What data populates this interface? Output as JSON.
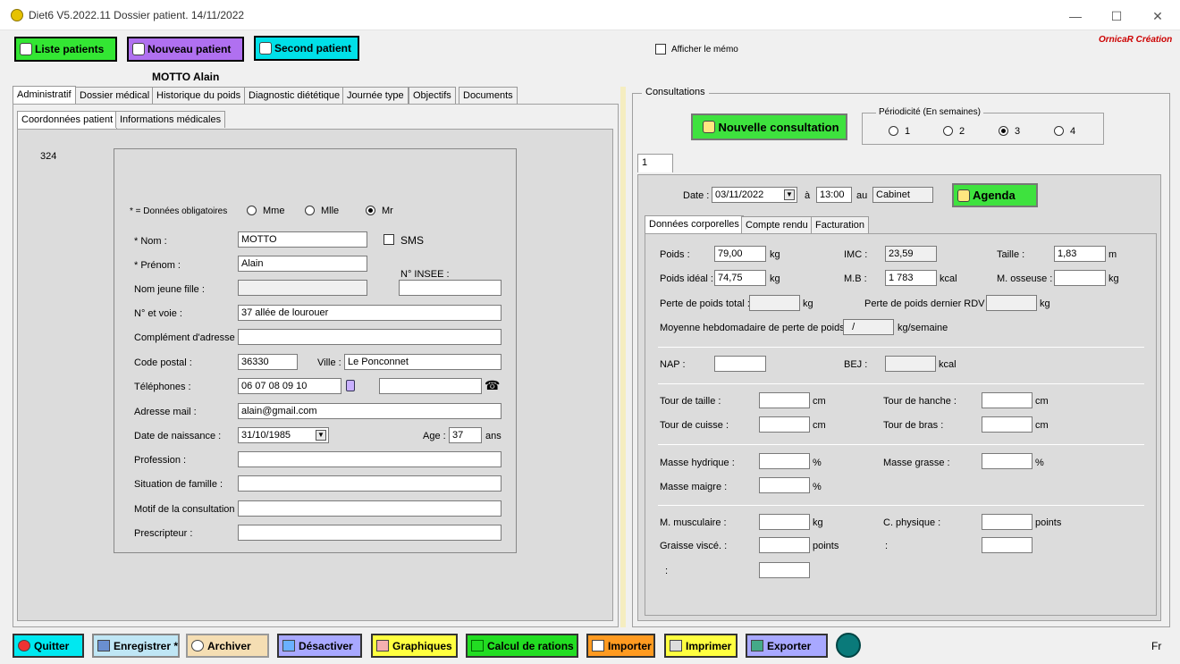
{
  "window": {
    "title": "Diet6  V5.2022.11    Dossier patient.  14/11/2022",
    "minimize": "—",
    "maximize": "☐",
    "close": "✕"
  },
  "topbar": {
    "list_patients": "Liste patients",
    "new_patient": "Nouveau patient",
    "second_patient": "Second patient",
    "show_memo": "Afficher le mémo",
    "brand": "OrnicaR Création"
  },
  "patient": {
    "name": "MOTTO Alain",
    "id": "324"
  },
  "main_tabs": [
    "Administratif",
    "Dossier médical",
    "Historique du poids",
    "Diagnostic diététique",
    "Journée type",
    "Objectifs",
    "Documents"
  ],
  "sub_tabs": [
    "Coordonnées patient",
    "Informations médicales"
  ],
  "form": {
    "required_note": "* = Données obligatoires",
    "civ_mme": "Mme",
    "civ_mlle": "Mlle",
    "civ_mr": "Mr",
    "nom_label": "* Nom :",
    "nom": "MOTTO",
    "sms": "SMS",
    "prenom_label": "* Prénom :",
    "prenom": "Alain",
    "insee_label": "N° INSEE :",
    "insee": "",
    "jeune_fille_label": "Nom jeune fille :",
    "jeune_fille": "",
    "voie_label": "N° et voie :",
    "voie": "37 allée de lourouer",
    "complement_label": "Complément d'adresse :",
    "complement": "",
    "cp_label": "Code postal :",
    "cp": "36330",
    "ville_label": "Ville :",
    "ville": "Le Ponconnet",
    "tel_label": "Téléphones :",
    "tel1": "06 07 08 09 10",
    "tel2": "",
    "mail_label": "Adresse mail :",
    "mail": "alain@gmail.com",
    "dob_label": "Date de naissance :",
    "dob": "31/10/1985",
    "age_label": "Age :",
    "age": "37",
    "ans": "ans",
    "profession_label": "Profession :",
    "profession": "",
    "situation_label": "Situation de famille :",
    "situation": "",
    "motif_label": "Motif de la consultation :",
    "motif": "",
    "prescripteur_label": "Prescripteur :",
    "prescripteur": ""
  },
  "consult": {
    "group": "Consultations",
    "new_btn": "Nouvelle consultation",
    "periodicity": "Périodicité (En semaines)",
    "p1": "1",
    "p2": "2",
    "p3": "3",
    "p4": "4",
    "number": "1",
    "date_label": "Date :",
    "date": "03/11/2022",
    "a": "à",
    "time": "13:00",
    "au": "au",
    "place": "Cabinet",
    "agenda": "Agenda",
    "tabs": [
      "Données corporelles",
      "Compte rendu",
      "Facturation"
    ],
    "poids_label": "Poids :",
    "poids": "79,00",
    "kg": "kg",
    "imc_label": "IMC :",
    "imc": "23,59",
    "taille_label": "Taille :",
    "taille": "1,83",
    "m": "m",
    "ideal_label": "Poids idéal :",
    "ideal": "74,75",
    "mb_label": "M.B :",
    "mb": "1 783",
    "kcal": "kcal",
    "osseuse_label": "M. osseuse :",
    "perte_total_label": "Perte de poids total :",
    "perte_rdv_label": "Perte de poids dernier RDV :",
    "moyenne_label": "Moyenne hebdomadaire de perte de poids :",
    "moyenne": "  /",
    "kg_semaine": "kg/semaine",
    "nap_label": "NAP :",
    "bej_label": "BEJ :",
    "taille_tour": "Tour de taille :",
    "hanche": "Tour de hanche :",
    "cuisse": "Tour de cuisse :",
    "bras": "Tour de bras :",
    "cm": "cm",
    "hydrique": "Masse hydrique :",
    "grasse": "Masse grasse :",
    "maigre": "Masse maigre :",
    "pct": "%",
    "musculaire": "M. musculaire :",
    "physique": "C. physique :",
    "points": "points",
    "visce": "Graisse viscé. :",
    "colon": ":"
  },
  "bottom": {
    "quit": "Quitter",
    "save": "Enregistrer *",
    "archive": "Archiver",
    "deactivate": "Désactiver",
    "charts": "Graphiques",
    "rations": "Calcul de rations",
    "import": "Importer",
    "print": "Imprimer",
    "export": "Exporter",
    "lang": "Fr"
  },
  "colors": {
    "list": "#33e633",
    "new": "#b070f0",
    "second": "#00e0e8",
    "consult": "#3ee23e",
    "agenda": "#3ee23e",
    "quit": "#00e8f0",
    "save": "#bfe6f5",
    "archive": "#f5deb3",
    "deact": "#a8a8ff",
    "graph": "#ffff40",
    "rations": "#22dd22",
    "import": "#ff9a20",
    "print": "#ffff40",
    "export": "#a8a8ff"
  }
}
